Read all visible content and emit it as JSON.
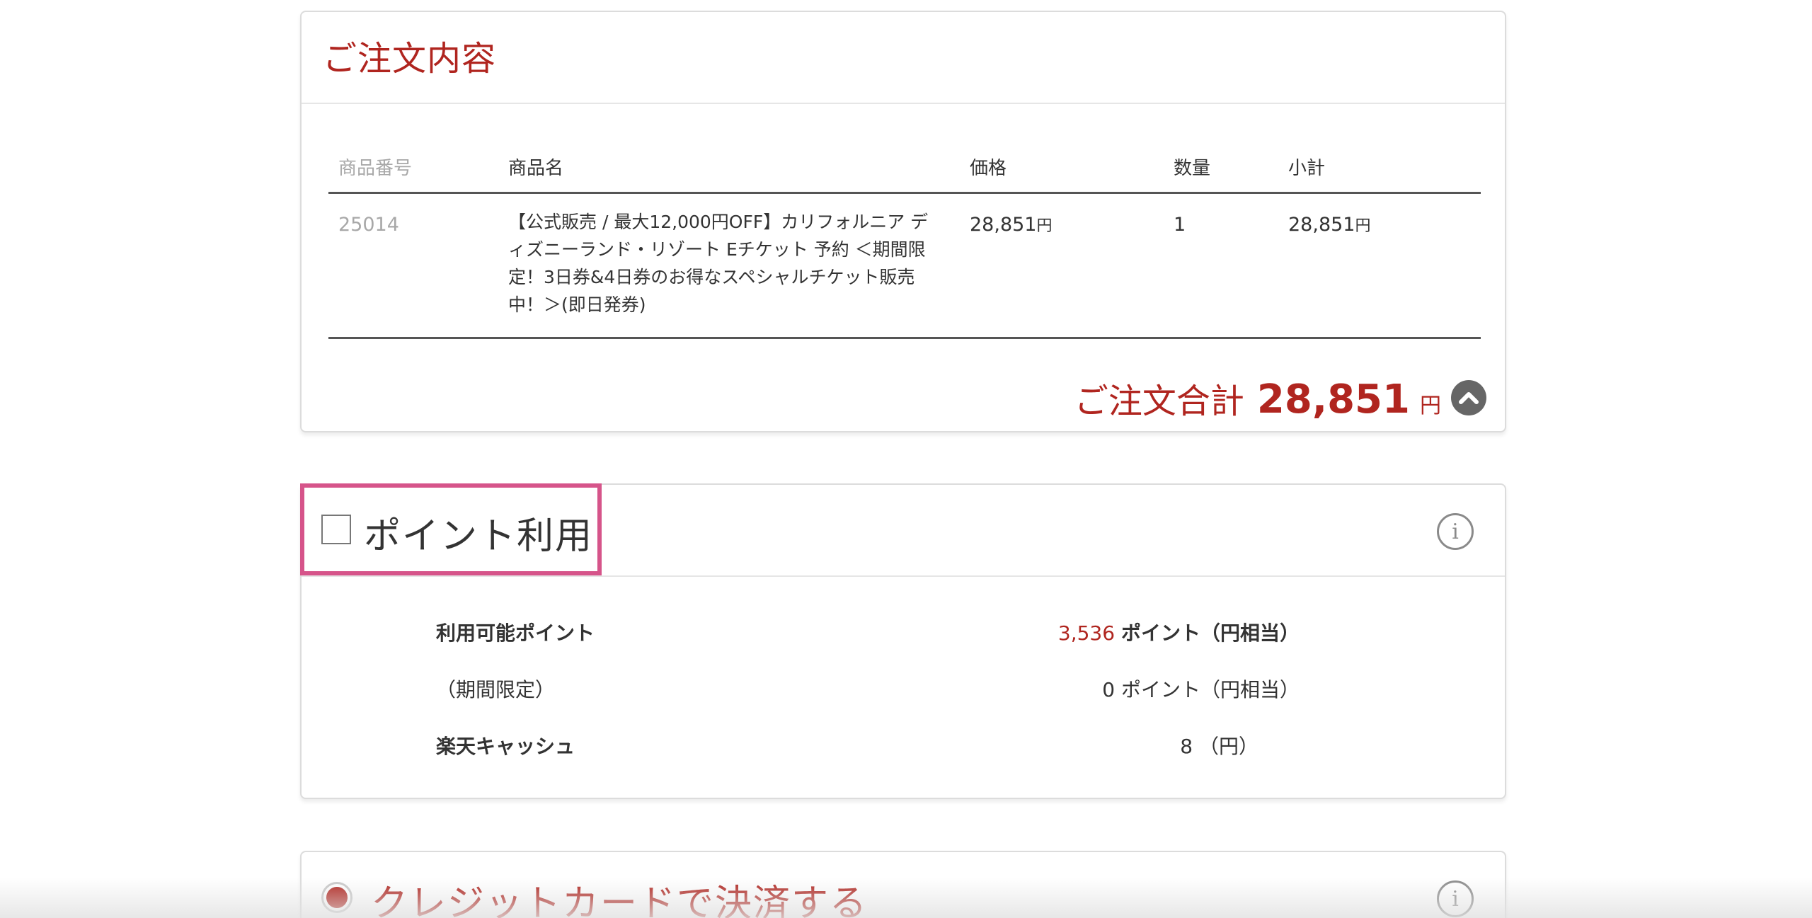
{
  "order": {
    "title": "ご注文内容",
    "columns": {
      "number": "商品番号",
      "name": "商品名",
      "price": "価格",
      "quantity": "数量",
      "subtotal": "小計"
    },
    "item": {
      "number": "25014",
      "name_lines": [
        "【公式販売 / 最大12,000円OFF】カリフォルニア デ",
        "ィズニーランド・リゾート Eチケット 予約 ＜期間限",
        "定！3日券&4日券のお得なスペシャルチケット販売",
        "中！＞(即日発券)"
      ],
      "price": "28,851",
      "price_unit": "円",
      "quantity": "1",
      "subtotal": "28,851",
      "subtotal_unit": "円"
    },
    "total_label": "ご注文合計",
    "total_value": "28,851",
    "total_unit": "円"
  },
  "points": {
    "title": "ポイント利用",
    "checked": false,
    "rows": [
      {
        "label": "利用可能ポイント",
        "amount": "3,536",
        "unit": "ポイント（円相当）"
      },
      {
        "label": "（期間限定）",
        "amount": "0",
        "unit": "ポイント（円相当）"
      },
      {
        "label": "楽天キャッシュ",
        "amount": "8",
        "unit": "（円）"
      }
    ]
  },
  "payment": {
    "title": "クレジットカードで決済する",
    "selected": true
  },
  "icons": {
    "info": "info-icon",
    "collapse": "chevron-up-icon"
  },
  "colors": {
    "accent": "#b0251f",
    "highlight": "#d6548a"
  }
}
